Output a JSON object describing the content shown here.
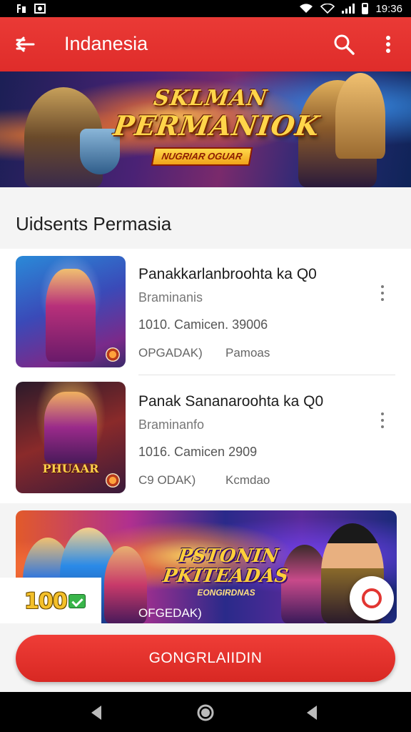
{
  "status_bar": {
    "time": "19:36"
  },
  "app_bar": {
    "title": "Indanesia"
  },
  "hero": {
    "title_line1": "SKLMAN",
    "title_line2": "PERMANIOK",
    "ribbon": "NUGRIAR OGUAR"
  },
  "section": {
    "header": "Uidsents Permasia"
  },
  "items": [
    {
      "title": "Panakkarlanbroohta ka Q0",
      "subtitle": "Braminanis",
      "meta": "1010. Camicen. 39006",
      "tag_left": "OPGADAK)",
      "tag_right": "Pamoas"
    },
    {
      "title": "Panak Sananaroohta ka Q0",
      "subtitle": "Braminanfo",
      "meta": "1016. Camicen 2909",
      "tag_left": "C9 ODAK)",
      "tag_right": "Kcmdao"
    }
  ],
  "thumb2": {
    "logo": "PHUAAR"
  },
  "promo": {
    "title_line1": "PSTONIN",
    "title_line2": "PKITEADAS",
    "subtitle": "EONGIRDNAS",
    "tag": "OFGEDAK)",
    "coin_value": "100"
  },
  "cta": {
    "label": "GONGRLAIIDIN"
  },
  "colors": {
    "brand_red": "#e23632",
    "coin_gold": "#f4c02a"
  }
}
